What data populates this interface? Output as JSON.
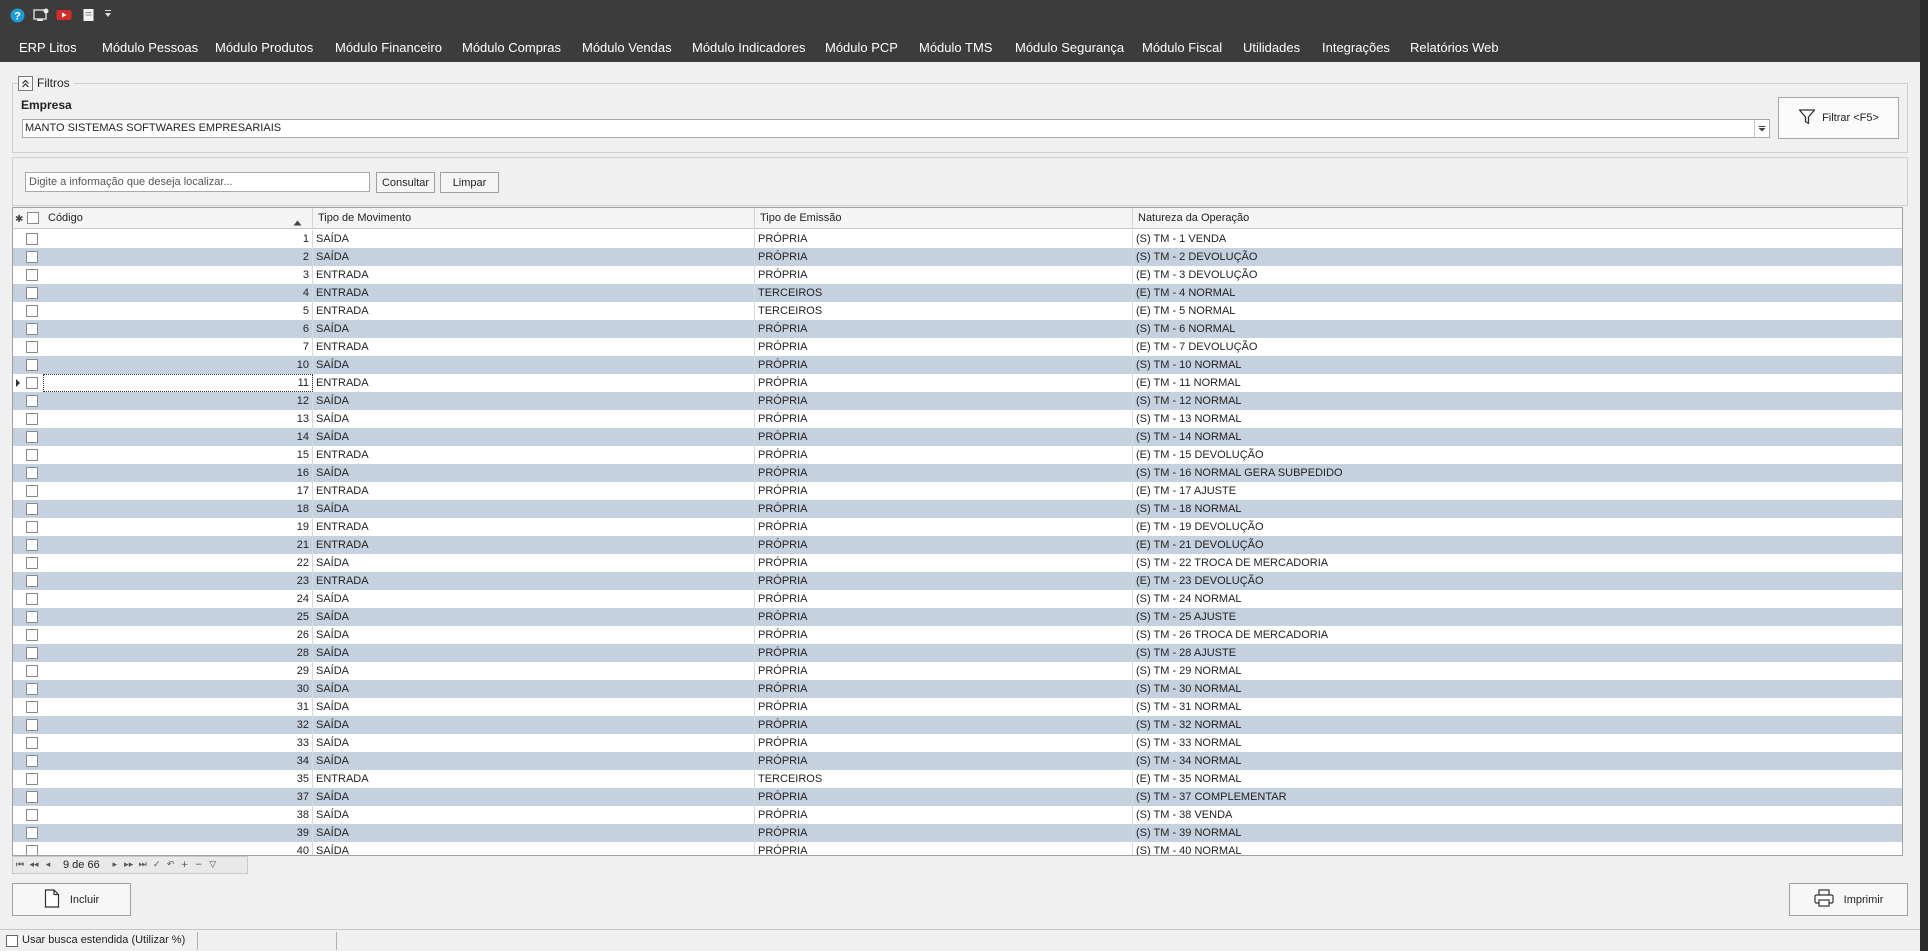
{
  "menu": {
    "items": [
      "ERP Litos",
      "Módulo Pessoas",
      "Módulo Produtos",
      "Módulo Financeiro",
      "Módulo Compras",
      "Módulo Vendas",
      "Módulo Indicadores",
      "Módulo PCP",
      "Módulo TMS",
      "Módulo Segurança",
      "Módulo Fiscal",
      "Utilidades",
      "Integrações",
      "Relatórios Web"
    ]
  },
  "filters": {
    "legend": "Filtros",
    "company_label": "Empresa",
    "company_value": "MANTO SISTEMAS SOFTWARES EMPRESARIAIS",
    "filter_button": "Filtrar <F5>"
  },
  "search": {
    "placeholder": "Digite a informação que deseja localizar...",
    "consult_label": "Consultar",
    "clear_label": "Limpar"
  },
  "grid": {
    "columns": [
      "Código",
      "Tipo de Movimento",
      "Tipo de Emissão",
      "Natureza da Operação"
    ],
    "selected_index": 8,
    "rows": [
      [
        "1",
        "SAÍDA",
        "PRÓPRIA",
        "(S) TM - 1 VENDA"
      ],
      [
        "2",
        "SAÍDA",
        "PRÓPRIA",
        "(S) TM - 2 DEVOLUÇÃO"
      ],
      [
        "3",
        "ENTRADA",
        "PRÓPRIA",
        "(E) TM - 3 DEVOLUÇÃO"
      ],
      [
        "4",
        "ENTRADA",
        "TERCEIROS",
        "(E) TM - 4 NORMAL"
      ],
      [
        "5",
        "ENTRADA",
        "TERCEIROS",
        "(E) TM - 5 NORMAL"
      ],
      [
        "6",
        "SAÍDA",
        "PRÓPRIA",
        "(S) TM - 6 NORMAL"
      ],
      [
        "7",
        "ENTRADA",
        "PRÓPRIA",
        "(E) TM - 7 DEVOLUÇÃO"
      ],
      [
        "10",
        "SAÍDA",
        "PRÓPRIA",
        "(S) TM - 10 NORMAL"
      ],
      [
        "11",
        "ENTRADA",
        "PRÓPRIA",
        "(E) TM - 11 NORMAL"
      ],
      [
        "12",
        "SAÍDA",
        "PRÓPRIA",
        "(S) TM - 12 NORMAL"
      ],
      [
        "13",
        "SAÍDA",
        "PRÓPRIA",
        "(S) TM - 13 NORMAL"
      ],
      [
        "14",
        "SAÍDA",
        "PRÓPRIA",
        "(S) TM - 14 NORMAL"
      ],
      [
        "15",
        "ENTRADA",
        "PRÓPRIA",
        "(E) TM - 15 DEVOLUÇÃO"
      ],
      [
        "16",
        "SAÍDA",
        "PRÓPRIA",
        "(S) TM - 16 NORMAL GERA SUBPEDIDO"
      ],
      [
        "17",
        "ENTRADA",
        "PRÓPRIA",
        "(E) TM - 17 AJUSTE"
      ],
      [
        "18",
        "SAÍDA",
        "PRÓPRIA",
        "(S) TM - 18 NORMAL"
      ],
      [
        "19",
        "ENTRADA",
        "PRÓPRIA",
        "(E) TM - 19 DEVOLUÇÃO"
      ],
      [
        "21",
        "ENTRADA",
        "PRÓPRIA",
        "(E) TM - 21 DEVOLUÇÃO"
      ],
      [
        "22",
        "SAÍDA",
        "PRÓPRIA",
        "(S) TM - 22 TROCA DE MERCADORIA"
      ],
      [
        "23",
        "ENTRADA",
        "PRÓPRIA",
        "(E) TM - 23 DEVOLUÇÃO"
      ],
      [
        "24",
        "SAÍDA",
        "PRÓPRIA",
        "(S) TM - 24 NORMAL"
      ],
      [
        "25",
        "SAÍDA",
        "PRÓPRIA",
        "(S) TM - 25 AJUSTE"
      ],
      [
        "26",
        "SAÍDA",
        "PRÓPRIA",
        "(S) TM - 26 TROCA DE MERCADORIA"
      ],
      [
        "28",
        "SAÍDA",
        "PRÓPRIA",
        "(S) TM - 28 AJUSTE"
      ],
      [
        "29",
        "SAÍDA",
        "PRÓPRIA",
        "(S) TM - 29 NORMAL"
      ],
      [
        "30",
        "SAÍDA",
        "PRÓPRIA",
        "(S) TM - 30 NORMAL"
      ],
      [
        "31",
        "SAÍDA",
        "PRÓPRIA",
        "(S) TM - 31 NORMAL"
      ],
      [
        "32",
        "SAÍDA",
        "PRÓPRIA",
        "(S) TM - 32 NORMAL"
      ],
      [
        "33",
        "SAÍDA",
        "PRÓPRIA",
        "(S) TM - 33 NORMAL"
      ],
      [
        "34",
        "SAÍDA",
        "PRÓPRIA",
        "(S) TM - 34 NORMAL"
      ],
      [
        "35",
        "ENTRADA",
        "TERCEIROS",
        "(E) TM - 35 NORMAL"
      ],
      [
        "37",
        "SAÍDA",
        "PRÓPRIA",
        "(S) TM - 37 COMPLEMENTAR"
      ],
      [
        "38",
        "SAÍDA",
        "PRÓPRIA",
        "(S) TM - 38 VENDA"
      ],
      [
        "39",
        "SAÍDA",
        "PRÓPRIA",
        "(S) TM - 39 NORMAL"
      ],
      [
        "40",
        "SAÍDA",
        "PRÓPRIA",
        "(S) TM - 40 NORMAL"
      ]
    ]
  },
  "navigator": {
    "count": "9 de 66"
  },
  "actions": {
    "include_label": "Incluir",
    "print_label": "Imprimir"
  },
  "status": {
    "extended_search_label": "Usar busca estendida (Utilizar %)"
  },
  "colors": {
    "chrome": "#3c3c3c",
    "row_alt": "#c6d1e0",
    "background": "#f0f0f0"
  }
}
